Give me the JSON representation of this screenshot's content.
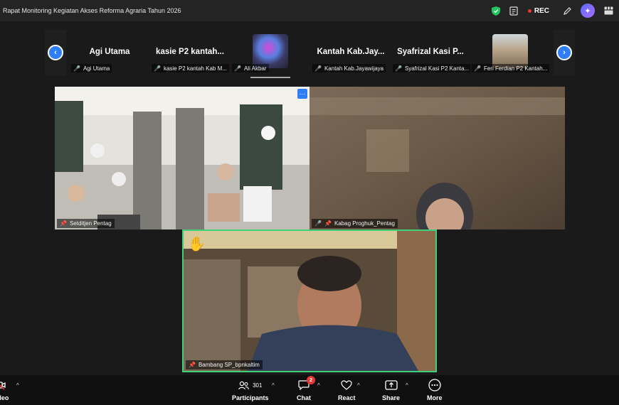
{
  "window": {
    "title": "Rapat Monitoring Kegiatan Akses Reforma Agraria Tahun 2026"
  },
  "topbar": {
    "rec_label": "REC"
  },
  "strip": {
    "thumbs": [
      {
        "big_name": "Agi Utama",
        "label": "Agi Utama"
      },
      {
        "big_name": "kasie P2 kantah...",
        "label": "kasie P2 kantah Kab M..."
      },
      {
        "big_name": "",
        "label": "Ali Akbar"
      },
      {
        "big_name": "Kantah Kab.Jay...",
        "label": "Kantah Kab.Jayawijaya"
      },
      {
        "big_name": "Syafrizal Kasi P...",
        "label": "Syafrizal Kasi P2 Kanta..."
      },
      {
        "big_name": "",
        "label": "Feri Ferdian P2 Kantah..."
      }
    ]
  },
  "videos": {
    "room": {
      "label": "Setditjen Pentag",
      "more": "···"
    },
    "woman": {
      "label": "Kabag Proghuk_Pentag"
    },
    "speaker": {
      "label": "Bambang SP_bpnkaltim",
      "hand": "✋"
    }
  },
  "toolbar": {
    "video_label": "Video",
    "participants_label": "Participants",
    "participants_count": "301",
    "chat_label": "Chat",
    "chat_badge": "2",
    "react_label": "React",
    "share_label": "Share",
    "more_label": "More"
  },
  "colors": {
    "accent": "#2d7ef7",
    "active_speaker_border": "#3ed17a",
    "rec": "#e53935",
    "shield": "#22c55e"
  },
  "icons": [
    "shield-icon",
    "notes-icon",
    "pen-icon",
    "ai-companion-icon",
    "layout-icon",
    "chevron-left-icon",
    "chevron-right-icon",
    "mic-muted-icon",
    "pin-icon",
    "participants-icon",
    "chat-icon",
    "react-icon",
    "share-icon",
    "more-icon"
  ]
}
